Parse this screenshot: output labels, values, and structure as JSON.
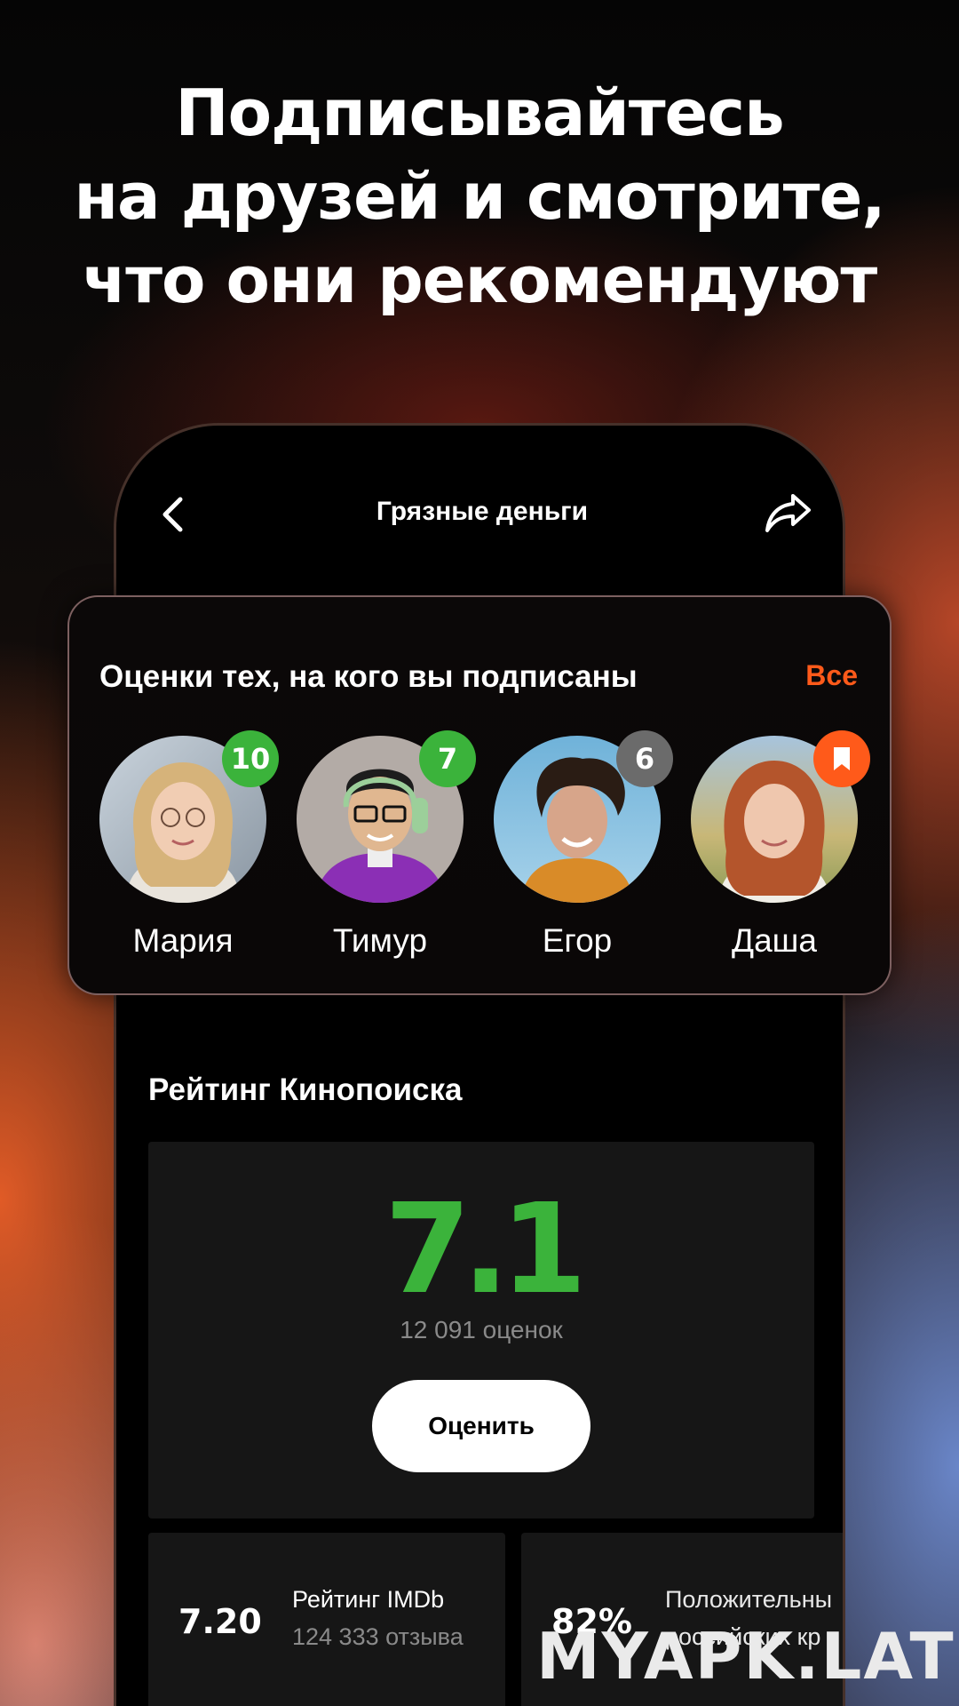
{
  "headline": {
    "lines": [
      "Подписывайтесь",
      "на друзей и смотрите,",
      "что они рекомендуют"
    ]
  },
  "topbar": {
    "movie_title": "Грязные деньги",
    "back_icon": "chevron-left-icon",
    "share_icon": "share-arrow-icon"
  },
  "friends": {
    "title": "Оценки тех, на кого вы подписаны",
    "all_label": "Все",
    "items": [
      {
        "name": "Мария",
        "badge": "10",
        "badge_color": "#3bb33b"
      },
      {
        "name": "Тимур",
        "badge": "7",
        "badge_color": "#3bb33b"
      },
      {
        "name": "Егор",
        "badge": "6",
        "badge_color": "#6b6b6b"
      },
      {
        "name": "Даша",
        "badge": "",
        "badge_icon": "bookmark-icon",
        "badge_color": "#ff5a1a"
      }
    ]
  },
  "kinopoisk": {
    "title": "Рейтинг Кинопоиска",
    "value": "7.1",
    "value_color": "#3bb33b",
    "count": "12 091 оценок",
    "rate_button": "Оценить"
  },
  "imdb": {
    "value": "7.20",
    "label": "Рейтинг IMDb",
    "count": "124 333 отзыва"
  },
  "positive": {
    "value": "82%",
    "label": "Положительны",
    "sub": "российских кр"
  },
  "watermark": "MYAPK.LAT",
  "colors": {
    "accent": "#ff5a1a",
    "green": "#3bb33b"
  }
}
